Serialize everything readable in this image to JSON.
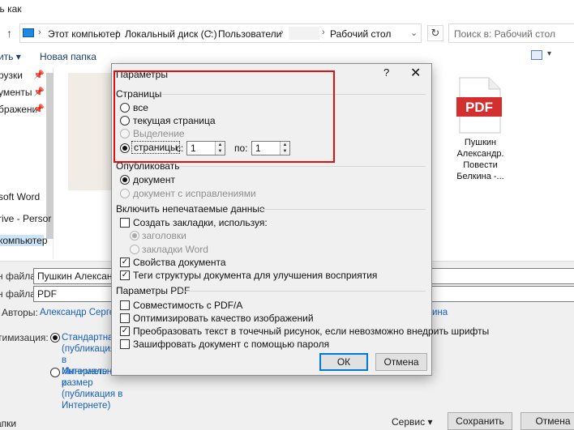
{
  "window": {
    "title_fragment": "ть как"
  },
  "address_bar": {
    "crumbs": [
      "Этот компьютер",
      "Локальный диск (C:)",
      "Пользователи",
      "Рабочий стол"
    ],
    "search_placeholder": "Поиск в: Рабочий стол"
  },
  "toolbar": {
    "organize_label": "ить",
    "new_folder_label": "Новая папка"
  },
  "sidebar": {
    "items": [
      "рузки",
      "ументы",
      "бражени",
      "soft Word",
      "rive - Persor",
      "компьютер"
    ]
  },
  "files": [
    {
      "name": "Пушкин Александр. Повести Белкина -...",
      "icon": "pdf-icon",
      "badge": "PDF",
      "color": "#d32f2f"
    }
  ],
  "bottom": {
    "filename_label": "н файла:",
    "filename_value": "Пушкин Александ",
    "filetype_label": "н файла:",
    "filetype_value": "PDF",
    "authors_label": "Авторы:",
    "authors_value": "Александр Сергее",
    "authors_right": "ина",
    "optimize_label": "тимизация:",
    "opt_standard": "Стандартная (публикация в Интернете и",
    "opt_minimal": "Минимальный размер (публикация в Интернете)",
    "hide_folders": "апки",
    "service_label": "Сервис",
    "save_button": "Сохранить",
    "cancel_button": "Отмена"
  },
  "dialog": {
    "title": "Параметры",
    "help": "?",
    "close": "✕",
    "pages": {
      "label": "Страницы",
      "all": "все",
      "current": "текущая страница",
      "selection": "Выделение",
      "pages": "страницы",
      "from_label": "с:",
      "from_value": "1",
      "to_label": "по:",
      "to_value": "1"
    },
    "publish": {
      "label": "Опубликовать",
      "document": "документ",
      "with_markup": "документ с исправлениями"
    },
    "nonprint": {
      "label": "Включить непечатаемые данные",
      "bookmarks": "Создать закладки, используя:",
      "headings": "заголовки",
      "word_bookmarks": "закладки Word",
      "properties": "Свойства документа",
      "structure_tags": "Теги структуры документа для улучшения восприятия"
    },
    "pdf": {
      "label": "Параметры PDF",
      "pdfa": "Совместимость с PDF/A",
      "optimize_images": "Оптимизировать качество изображений",
      "bitmap_text": "Преобразовать текст в точечный рисунок, если невозможно внедрить шрифты",
      "encrypt": "Зашифровать документ с помощью пароля"
    },
    "ok": "ОК",
    "cancel": "Отмена"
  },
  "colors": {
    "accent": "#0078d7",
    "highlight": "#e01010",
    "pdf_red": "#d32f2f"
  }
}
